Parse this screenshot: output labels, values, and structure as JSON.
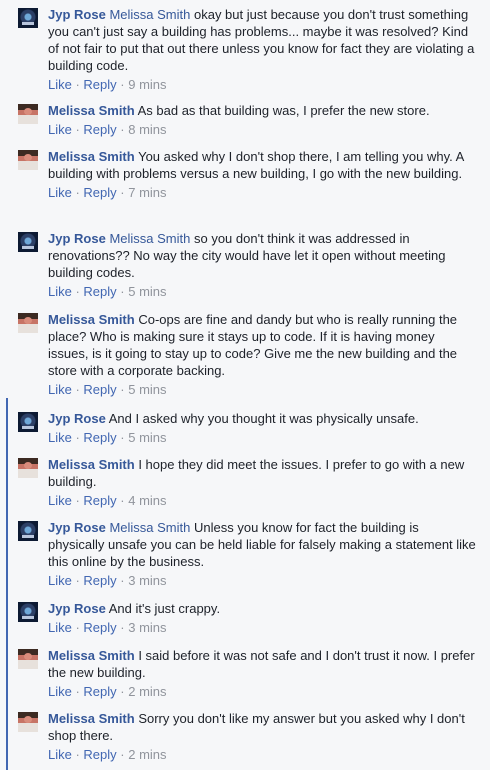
{
  "comments": [
    {
      "author": "Jyp Rose",
      "avatar": "jyp-rose-avatar",
      "mention": "Melissa Smith",
      "text": "okay but just because you don't trust something you can't just say a building has problems... maybe it was resolved? Kind of not fair to put that out there unless you know for fact they are violating a building code.",
      "like": "Like",
      "reply": "Reply",
      "time": "9 mins"
    },
    {
      "author": "Melissa Smith",
      "avatar": "melissa-smith-avatar",
      "mention": "",
      "text": "As bad as that building was, I prefer the new store.",
      "like": "Like",
      "reply": "Reply",
      "time": "8 mins"
    },
    {
      "author": "Melissa Smith",
      "avatar": "melissa-smith-avatar",
      "mention": "",
      "text": "You asked why I don't shop there, I am telling you why. A building with problems versus a new building, I go with the new building.",
      "like": "Like",
      "reply": "Reply",
      "time": "7 mins"
    },
    {
      "author": "Jyp Rose",
      "avatar": "jyp-rose-avatar",
      "mention": "Melissa Smith",
      "text": "so you don't think it was addressed in renovations?? No way the city would have let it open without meeting building codes.",
      "like": "Like",
      "reply": "Reply",
      "time": "5 mins"
    },
    {
      "author": "Melissa Smith",
      "avatar": "melissa-smith-avatar",
      "mention": "",
      "text": "Co-ops are fine and dandy but who is really running the place? Who is making sure it stays up to code. If it is having money issues, is it going to stay up to code? Give me the new building and the store with a corporate backing.",
      "like": "Like",
      "reply": "Reply",
      "time": "5 mins"
    },
    {
      "author": "Jyp Rose",
      "avatar": "jyp-rose-avatar",
      "mention": "",
      "text": "And I asked why you thought it was physically unsafe.",
      "like": "Like",
      "reply": "Reply",
      "time": "5 mins"
    },
    {
      "author": "Melissa Smith",
      "avatar": "melissa-smith-avatar",
      "mention": "",
      "text": "I hope they did meet the issues. I prefer to go with a new building.",
      "like": "Like",
      "reply": "Reply",
      "time": "4 mins"
    },
    {
      "author": "Jyp Rose",
      "avatar": "jyp-rose-avatar",
      "mention": "Melissa Smith",
      "text": "Unless you know for fact the building is physically unsafe you can be held liable for falsely making a statement like this online by the business.",
      "like": "Like",
      "reply": "Reply",
      "time": "3 mins"
    },
    {
      "author": "Jyp Rose",
      "avatar": "jyp-rose-avatar",
      "mention": "",
      "text": "And it's just crappy.",
      "like": "Like",
      "reply": "Reply",
      "time": "3 mins"
    },
    {
      "author": "Melissa Smith",
      "avatar": "melissa-smith-avatar",
      "mention": "",
      "text": "I said before it was not safe and I don't trust it now. I prefer the new building.",
      "like": "Like",
      "reply": "Reply",
      "time": "2 mins"
    },
    {
      "author": "Melissa Smith",
      "avatar": "melissa-smith-avatar",
      "mention": "",
      "text": "Sorry you don't like my answer but you asked why I don't shop there.",
      "like": "Like",
      "reply": "Reply",
      "time": "2 mins"
    }
  ]
}
